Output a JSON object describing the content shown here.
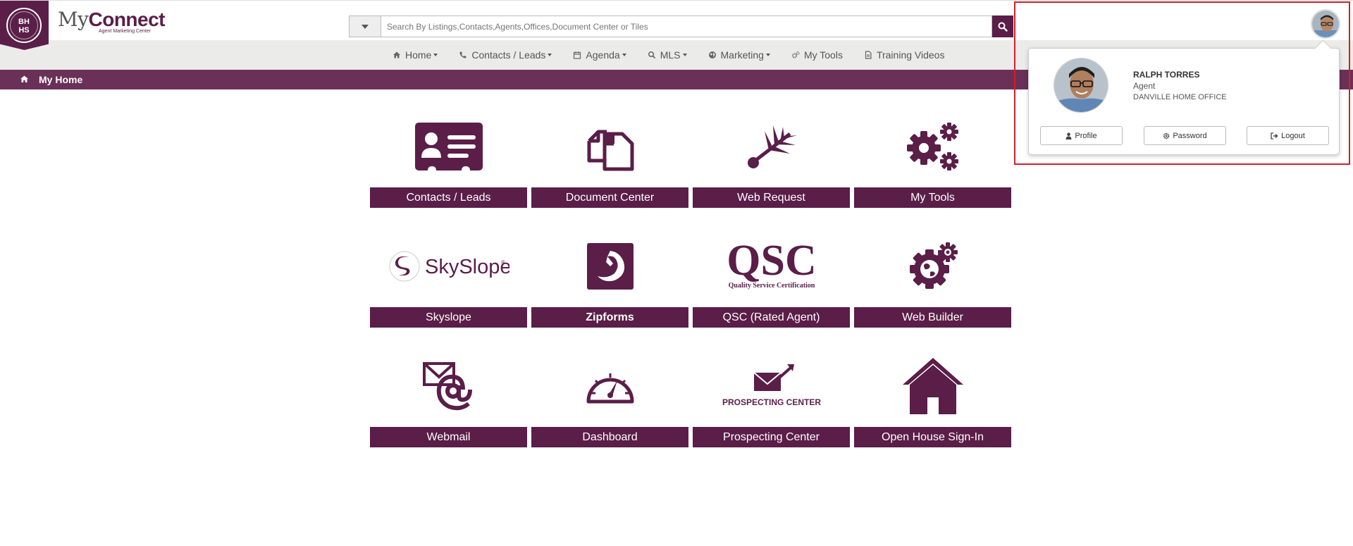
{
  "brand": {
    "logo_text": "BH HS",
    "name_my": "My",
    "name_connect": "Connect",
    "tagline": "Agent Marketing Center"
  },
  "search": {
    "placeholder": "Search By Listings,Contacts,Agents,Offices,Document Center or Tiles"
  },
  "nav": {
    "items": [
      {
        "label": "Home",
        "icon": "home-icon",
        "dropdown": true
      },
      {
        "label": "Contacts / Leads",
        "icon": "phone-icon",
        "dropdown": true
      },
      {
        "label": "Agenda",
        "icon": "calendar-icon",
        "dropdown": true
      },
      {
        "label": "MLS",
        "icon": "search-icon",
        "dropdown": true
      },
      {
        "label": "Marketing",
        "icon": "globe-icon",
        "dropdown": true
      },
      {
        "label": "My Tools",
        "icon": "gears-icon",
        "dropdown": false
      },
      {
        "label": "Training Videos",
        "icon": "document-icon",
        "dropdown": false
      }
    ]
  },
  "breadcrumb": {
    "label": "My Home"
  },
  "tiles": [
    {
      "label": "Contacts / Leads",
      "icon": "contact-card-icon"
    },
    {
      "label": "Document Center",
      "icon": "documents-icon"
    },
    {
      "label": "Web Request",
      "icon": "web-request-icon"
    },
    {
      "label": "My Tools",
      "icon": "gears-icon"
    },
    {
      "label": "Skyslope",
      "icon": "skyslope-logo",
      "logo_text": "SkySlope"
    },
    {
      "label": "Zipforms",
      "icon": "zipforms-logo"
    },
    {
      "label": "QSC (Rated Agent)",
      "icon": "qsc-logo",
      "logo_text": "QSC",
      "logo_subtext": "Quality Service Certification"
    },
    {
      "label": "Web Builder",
      "icon": "web-builder-icon"
    },
    {
      "label": "Webmail",
      "icon": "webmail-icon"
    },
    {
      "label": "Dashboard",
      "icon": "dashboard-icon"
    },
    {
      "label": "Prospecting Center",
      "icon": "prospecting-icon",
      "logo_text": "PROSPECTING CENTER"
    },
    {
      "label": "Open House Sign-In",
      "icon": "house-icon"
    }
  ],
  "user_popup": {
    "name": "RALPH TORRES",
    "role": "Agent",
    "office": "DANVILLE HOME OFFICE",
    "buttons": {
      "profile": "Profile",
      "password": "Password",
      "logout": "Logout"
    }
  },
  "colors": {
    "brand": "#5a1e48",
    "breadcrumb_bar": "#6a3058",
    "highlight": "#d0202a"
  }
}
